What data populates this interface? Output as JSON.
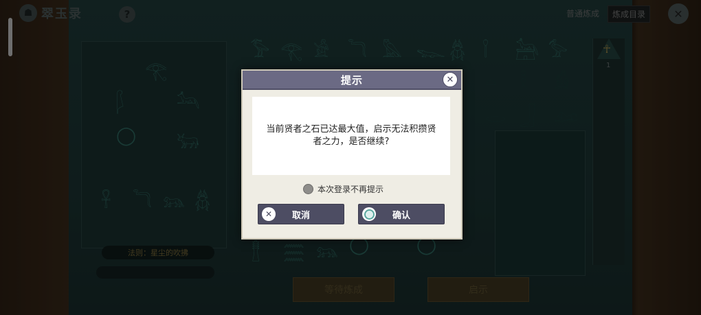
{
  "app": {
    "title": "翠玉录",
    "help_icon": "?"
  },
  "tabs": [
    {
      "label": "普通炼成",
      "active": false
    },
    {
      "label": "炼成目录",
      "active": true
    }
  ],
  "left_panel": {
    "law_label": "法则：星尘的吹拂"
  },
  "ankh": {
    "glyph": "☥",
    "count": "1"
  },
  "buttons": {
    "wait_refine": "等待炼成",
    "revelation": "启示"
  },
  "dialog": {
    "title": "提示",
    "message": "当前贤者之石已达最大值，启示无法积攒贤者之力，是否继续?",
    "no_prompt_label": "本次登录不再提示",
    "cancel_label": "取消",
    "confirm_label": "确认"
  },
  "colors": {
    "dialog_header": "#6b6a84",
    "dialog_button": "#4d4d63",
    "board": "#1f3b3a",
    "gold": "#a28b48"
  }
}
